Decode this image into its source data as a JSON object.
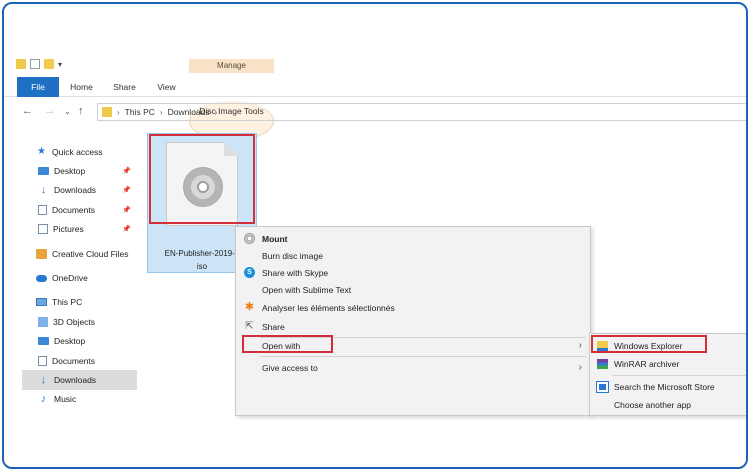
{
  "ribbon": {
    "manage_label": "Manage",
    "tabs": [
      "File",
      "Home",
      "Share",
      "View",
      "Disc Image Tools"
    ]
  },
  "address": {
    "crumbs": [
      "This PC",
      "Downloads"
    ]
  },
  "sidebar": {
    "items": [
      {
        "label": "Quick access",
        "icon": "star-icon"
      },
      {
        "label": "Desktop",
        "icon": "desktop-icon",
        "pinned": true
      },
      {
        "label": "Downloads",
        "icon": "download-arrow-icon",
        "pinned": true
      },
      {
        "label": "Documents",
        "icon": "documents-icon",
        "pinned": true
      },
      {
        "label": "Pictures",
        "icon": "pictures-icon",
        "pinned": true
      },
      {
        "label": "Creative Cloud Files",
        "icon": "creative-cloud-folder-icon"
      },
      {
        "label": "OneDrive",
        "icon": "onedrive-cloud-icon"
      },
      {
        "label": "This PC",
        "icon": "this-pc-icon"
      },
      {
        "label": "3D Objects",
        "icon": "3d-objects-icon"
      },
      {
        "label": "Desktop",
        "icon": "desktop-icon"
      },
      {
        "label": "Documents",
        "icon": "documents-icon"
      },
      {
        "label": "Downloads",
        "icon": "download-arrow-icon",
        "selected": true
      },
      {
        "label": "Music",
        "icon": "music-icon"
      }
    ]
  },
  "file": {
    "name_line1": "EN-Publisher-2019-6",
    "name_line2": "iso"
  },
  "context_menu": {
    "items": [
      {
        "label": "Mount",
        "icon": "disc-icon",
        "bold": true
      },
      {
        "label": "Burn disc image"
      },
      {
        "label": "Share with Skype",
        "icon": "skype-icon"
      },
      {
        "label": "Open with Sublime Text"
      },
      {
        "label": "Analyser les éléments sélectionnés",
        "icon": "avast-icon"
      },
      {
        "label": "Share",
        "icon": "share-icon"
      },
      {
        "label": "Open with",
        "submenu": true
      },
      {
        "label": "Give access to",
        "submenu": true
      }
    ]
  },
  "submenu": {
    "items": [
      {
        "label": "Windows Explorer",
        "icon": "windows-explorer-icon"
      },
      {
        "label": "WinRAR archiver",
        "icon": "winrar-icon"
      },
      {
        "label": "Search the Microsoft Store",
        "icon": "microsoft-store-icon"
      },
      {
        "label": "Choose another app"
      }
    ]
  },
  "colors": {
    "accent": "#1f6fc4",
    "highlight_box": "#d32f3a",
    "selection": "#cce4f7",
    "manage_tab": "#f8e3c8"
  }
}
